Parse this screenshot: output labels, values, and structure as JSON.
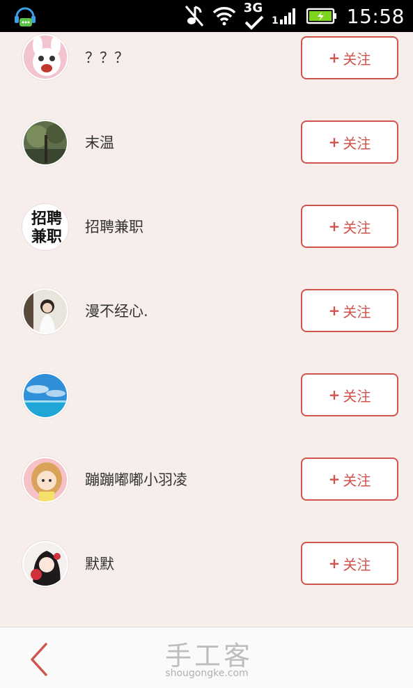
{
  "status_bar": {
    "time": "15:58",
    "network_label": "3G",
    "icons": [
      "chat-app-icon",
      "music-muted-icon",
      "wifi-icon",
      "network-3g-icon",
      "signal-icon",
      "battery-icon"
    ]
  },
  "users": [
    {
      "name": "？？？",
      "follow_label": "关注",
      "avatar": "rabbit-avatar"
    },
    {
      "name": "末温",
      "follow_label": "关注",
      "avatar": "forest-avatar"
    },
    {
      "name": "招聘兼职",
      "follow_label": "关注",
      "avatar": "recruit-text-avatar",
      "avatar_text": "招聘兼职"
    },
    {
      "name": "漫不经心.",
      "follow_label": "关注",
      "avatar": "girl-photo-avatar"
    },
    {
      "name": "",
      "follow_label": "关注",
      "avatar": "sea-sky-avatar"
    },
    {
      "name": "蹦蹦嘟嘟小羽凌",
      "follow_label": "关注",
      "avatar": "cartoon-girl-avatar"
    },
    {
      "name": "默默",
      "follow_label": "关注",
      "avatar": "dark-hair-girl-avatar"
    }
  ],
  "follow_plus": "+",
  "bottom_bar": {
    "logo_text": "手工客",
    "logo_subtext": "shougongke.com"
  },
  "colors": {
    "accent": "#d0534c",
    "background": "#f7eeec"
  }
}
